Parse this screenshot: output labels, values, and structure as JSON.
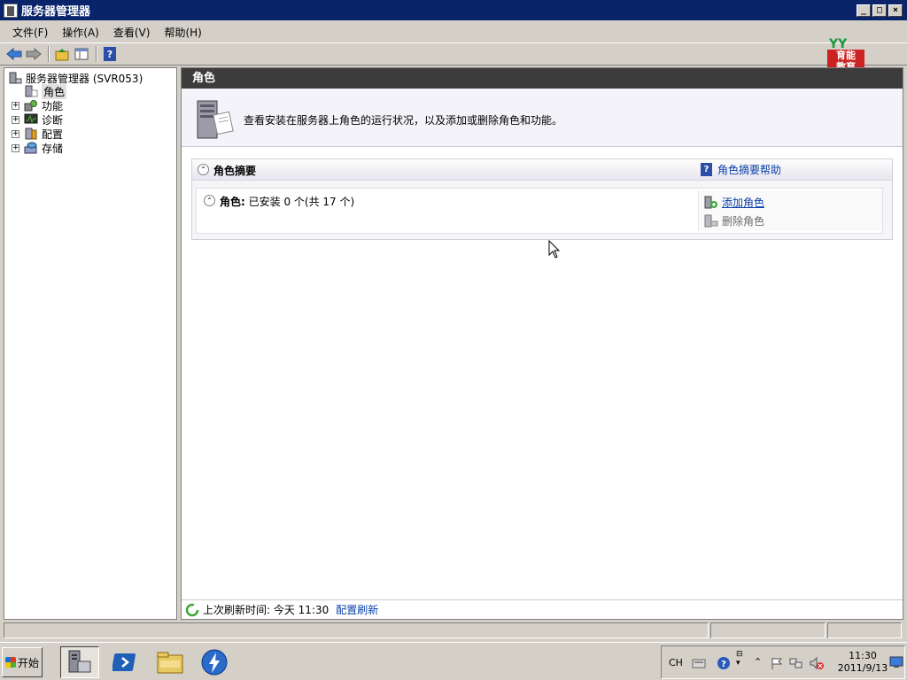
{
  "window": {
    "title": "服务器管理器"
  },
  "menu": [
    "文件(F)",
    "操作(A)",
    "查看(V)",
    "帮助(H)"
  ],
  "watermark": {
    "top": "YY",
    "bottom": "育能\n教育"
  },
  "tree": {
    "root": "服务器管理器 (SVR053)",
    "items": [
      {
        "label": "角色",
        "expandable": false,
        "selected": true,
        "icon": "roles-icon"
      },
      {
        "label": "功能",
        "expandable": true,
        "icon": "features-icon"
      },
      {
        "label": "诊断",
        "expandable": true,
        "icon": "diagnostics-icon"
      },
      {
        "label": "配置",
        "expandable": true,
        "icon": "configuration-icon"
      },
      {
        "label": "存储",
        "expandable": true,
        "icon": "storage-icon"
      }
    ]
  },
  "main": {
    "header": "角色",
    "description": "查看安装在服务器上角色的运行状况，以及添加或删除角色和功能。",
    "summary": {
      "title": "角色摘要",
      "help_link": "角色摘要帮助",
      "roles_label": "角色:",
      "roles_status": "已安装 0 个(共 17 个)",
      "actions": {
        "add": "添加角色",
        "remove": "删除角色"
      }
    },
    "status": {
      "text": "上次刷新时间: 今天 11:30",
      "link": "配置刷新"
    }
  },
  "taskbar": {
    "start": "开始",
    "lang": "CH",
    "time": "11:30",
    "date": "2011/9/13"
  },
  "colors": {
    "titlebar": "#0a246a",
    "link": "#0a3ea8",
    "header": "#3c3c3c"
  }
}
